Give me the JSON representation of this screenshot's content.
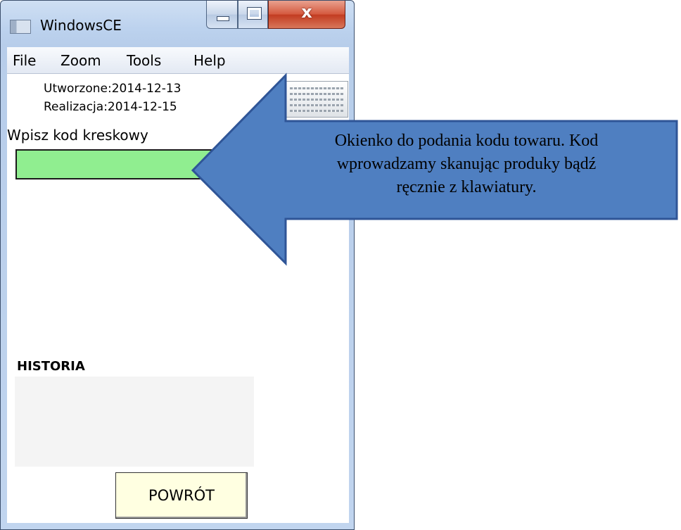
{
  "window": {
    "title": "WindowsCE",
    "close_glyph": "x"
  },
  "menu": {
    "items": [
      "File",
      "Zoom",
      "Tools",
      "Help"
    ]
  },
  "info": {
    "created": "Utworzone:2014-12-13",
    "realization": "Realizacja:2014-12-15"
  },
  "barcode": {
    "label": "Wpisz kod kreskowy",
    "value": "",
    "color": "#90ee90"
  },
  "history": {
    "label": "HISTORIA",
    "items": []
  },
  "buttons": {
    "back_label": "POWRÓT"
  },
  "callout": {
    "lines": [
      "Okienko do podania kodu towaru. Kod",
      "wprowadzamy skanując produky bądź",
      "ręcznie z klawiatury."
    ],
    "fill": "#4f7fc1"
  },
  "icons": {
    "app": "window-app-icon",
    "keyboard": "keyboard-icon"
  }
}
